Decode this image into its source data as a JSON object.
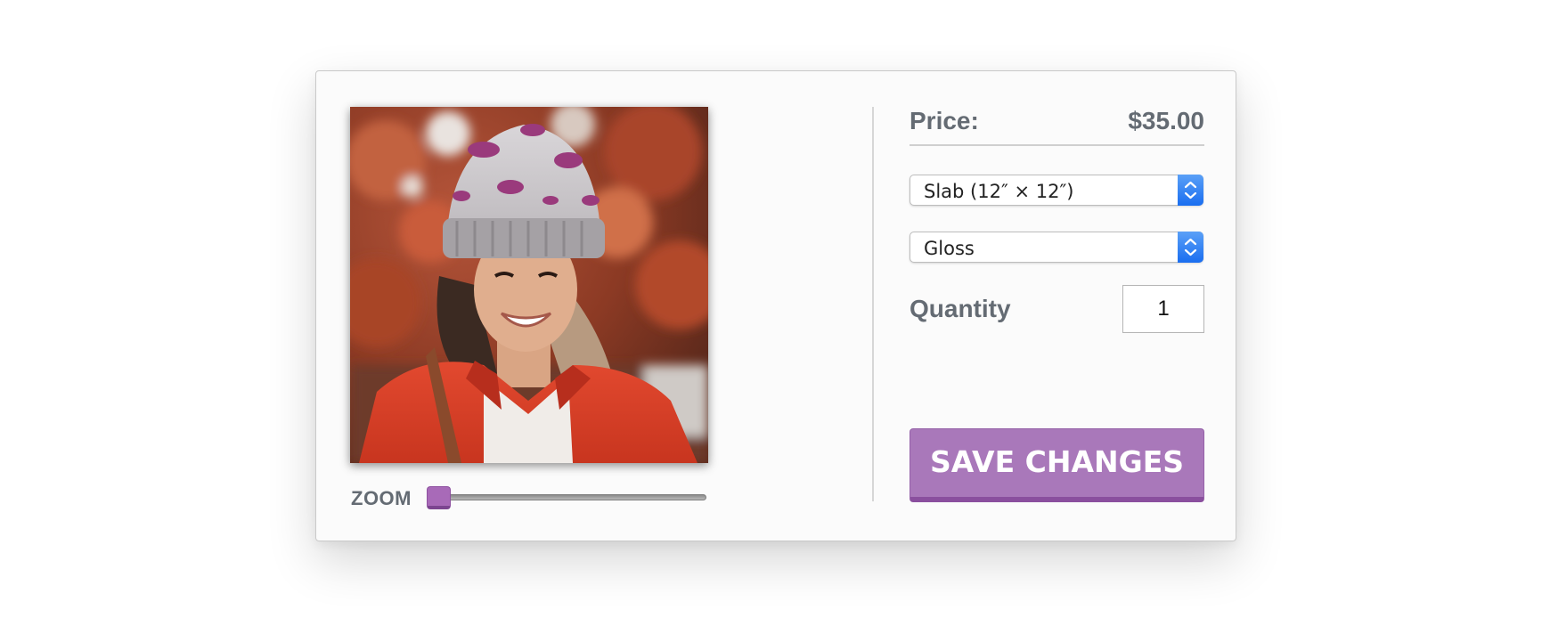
{
  "editor": {
    "photo": {
      "description_icon": "portrait-photo"
    },
    "zoom": {
      "label": "ZOOM",
      "value": 0
    }
  },
  "order": {
    "price_label": "Price:",
    "price_value": "$35.00",
    "size_select": {
      "selected": "Slab (12″ × 12″)"
    },
    "finish_select": {
      "selected": "Gloss"
    },
    "quantity_label": "Quantity",
    "quantity_value": "1",
    "save_label": "SAVE CHANGES"
  },
  "colors": {
    "accent": "#a978ba",
    "select_arrow": "#2f7ff5",
    "label_text": "#646b73"
  }
}
